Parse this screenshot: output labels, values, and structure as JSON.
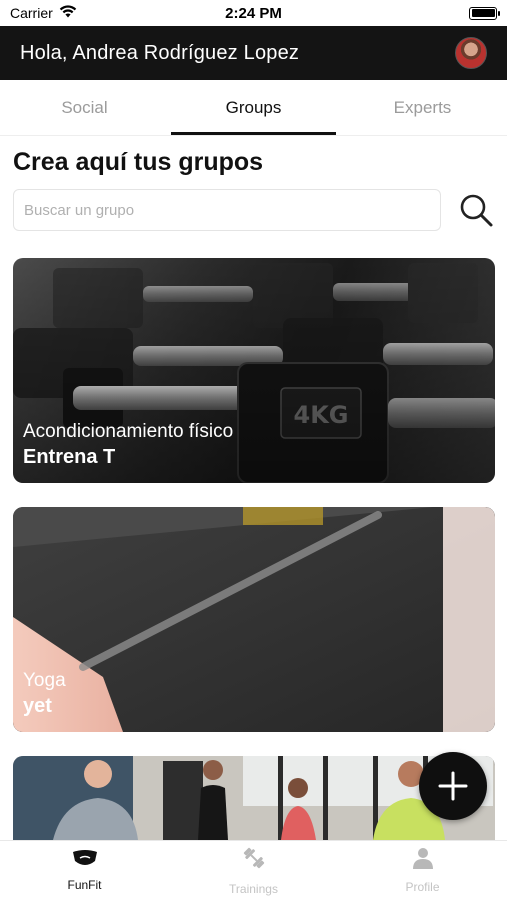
{
  "status_bar": {
    "carrier": "Carrier",
    "time": "2:24 PM",
    "battery_level": 1.0
  },
  "header": {
    "greeting": "Hola, Andrea Rodríguez Lopez",
    "avatar_icon": "user-avatar"
  },
  "tabs": [
    {
      "label": "Social",
      "active": false
    },
    {
      "label": "Groups",
      "active": true
    },
    {
      "label": "Experts",
      "active": false
    }
  ],
  "section": {
    "title": "Crea aquí tus grupos"
  },
  "search": {
    "placeholder": "Buscar un grupo",
    "value": "",
    "icon": "search-icon"
  },
  "groups": [
    {
      "category": "Acondicionamiento físico",
      "name": "Entrena T",
      "image": "dumbbells"
    },
    {
      "category": "Yoga",
      "name": "yet",
      "image": "yoga-mat"
    },
    {
      "category": "",
      "name": "",
      "image": "group-training"
    }
  ],
  "fab": {
    "icon": "plus-icon"
  },
  "bottom_nav": [
    {
      "label": "FunFit",
      "icon": "mask-icon",
      "active": true
    },
    {
      "label": "Trainings",
      "icon": "dumbbell-icon",
      "active": false
    },
    {
      "label": "Profile",
      "icon": "person-icon",
      "active": false
    }
  ],
  "colors": {
    "header_bg": "#141414",
    "accent": "#111111",
    "inactive": "#9b9b9b",
    "nav_inactive": "#c4c4c4"
  }
}
